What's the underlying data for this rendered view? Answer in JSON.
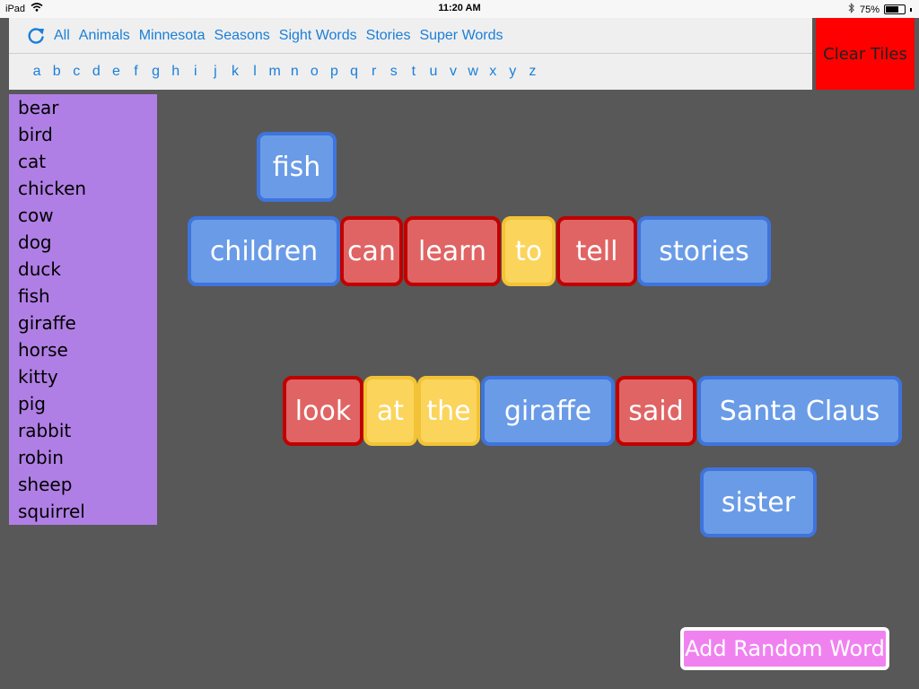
{
  "status_bar": {
    "device": "iPad",
    "time": "11:20 AM",
    "battery": "75%",
    "battery_level": 0.75
  },
  "categories": [
    "All",
    "Animals",
    "Minnesota",
    "Seasons",
    "Sight Words",
    "Stories",
    "Super Words"
  ],
  "alphabet": [
    "a",
    "b",
    "c",
    "d",
    "e",
    "f",
    "g",
    "h",
    "i",
    "j",
    "k",
    "l",
    "m",
    "n",
    "o",
    "p",
    "q",
    "r",
    "s",
    "t",
    "u",
    "v",
    "w",
    "x",
    "y",
    "z"
  ],
  "clear_button": "Clear Tiles",
  "word_list": [
    "bear",
    "bird",
    "cat",
    "chicken",
    "cow",
    "dog",
    "duck",
    "fish",
    "giraffe",
    "horse",
    "kitty",
    "pig",
    "rabbit",
    "robin",
    "sheep",
    "squirrel"
  ],
  "tiles": [
    {
      "text": "fish",
      "color": "blue"
    },
    {
      "text": "children",
      "color": "blue"
    },
    {
      "text": "can",
      "color": "red"
    },
    {
      "text": "learn",
      "color": "red"
    },
    {
      "text": "to",
      "color": "yellow"
    },
    {
      "text": "tell",
      "color": "red"
    },
    {
      "text": "stories",
      "color": "blue"
    },
    {
      "text": "look",
      "color": "red"
    },
    {
      "text": "at",
      "color": "yellow"
    },
    {
      "text": "the",
      "color": "yellow"
    },
    {
      "text": "giraffe",
      "color": "blue"
    },
    {
      "text": "said",
      "color": "red"
    },
    {
      "text": "Santa Claus",
      "color": "blue"
    },
    {
      "text": "sister",
      "color": "blue"
    }
  ],
  "add_button": "Add Random Word",
  "colors": {
    "background": "#585858",
    "link": "#1a7fd9",
    "clear": "#ff0000",
    "word_list": "#b07fe5",
    "add_button": "#f082f0",
    "tile_blue": "#6a9be7",
    "tile_red": "#e06464",
    "tile_yellow": "#fbd45c"
  }
}
